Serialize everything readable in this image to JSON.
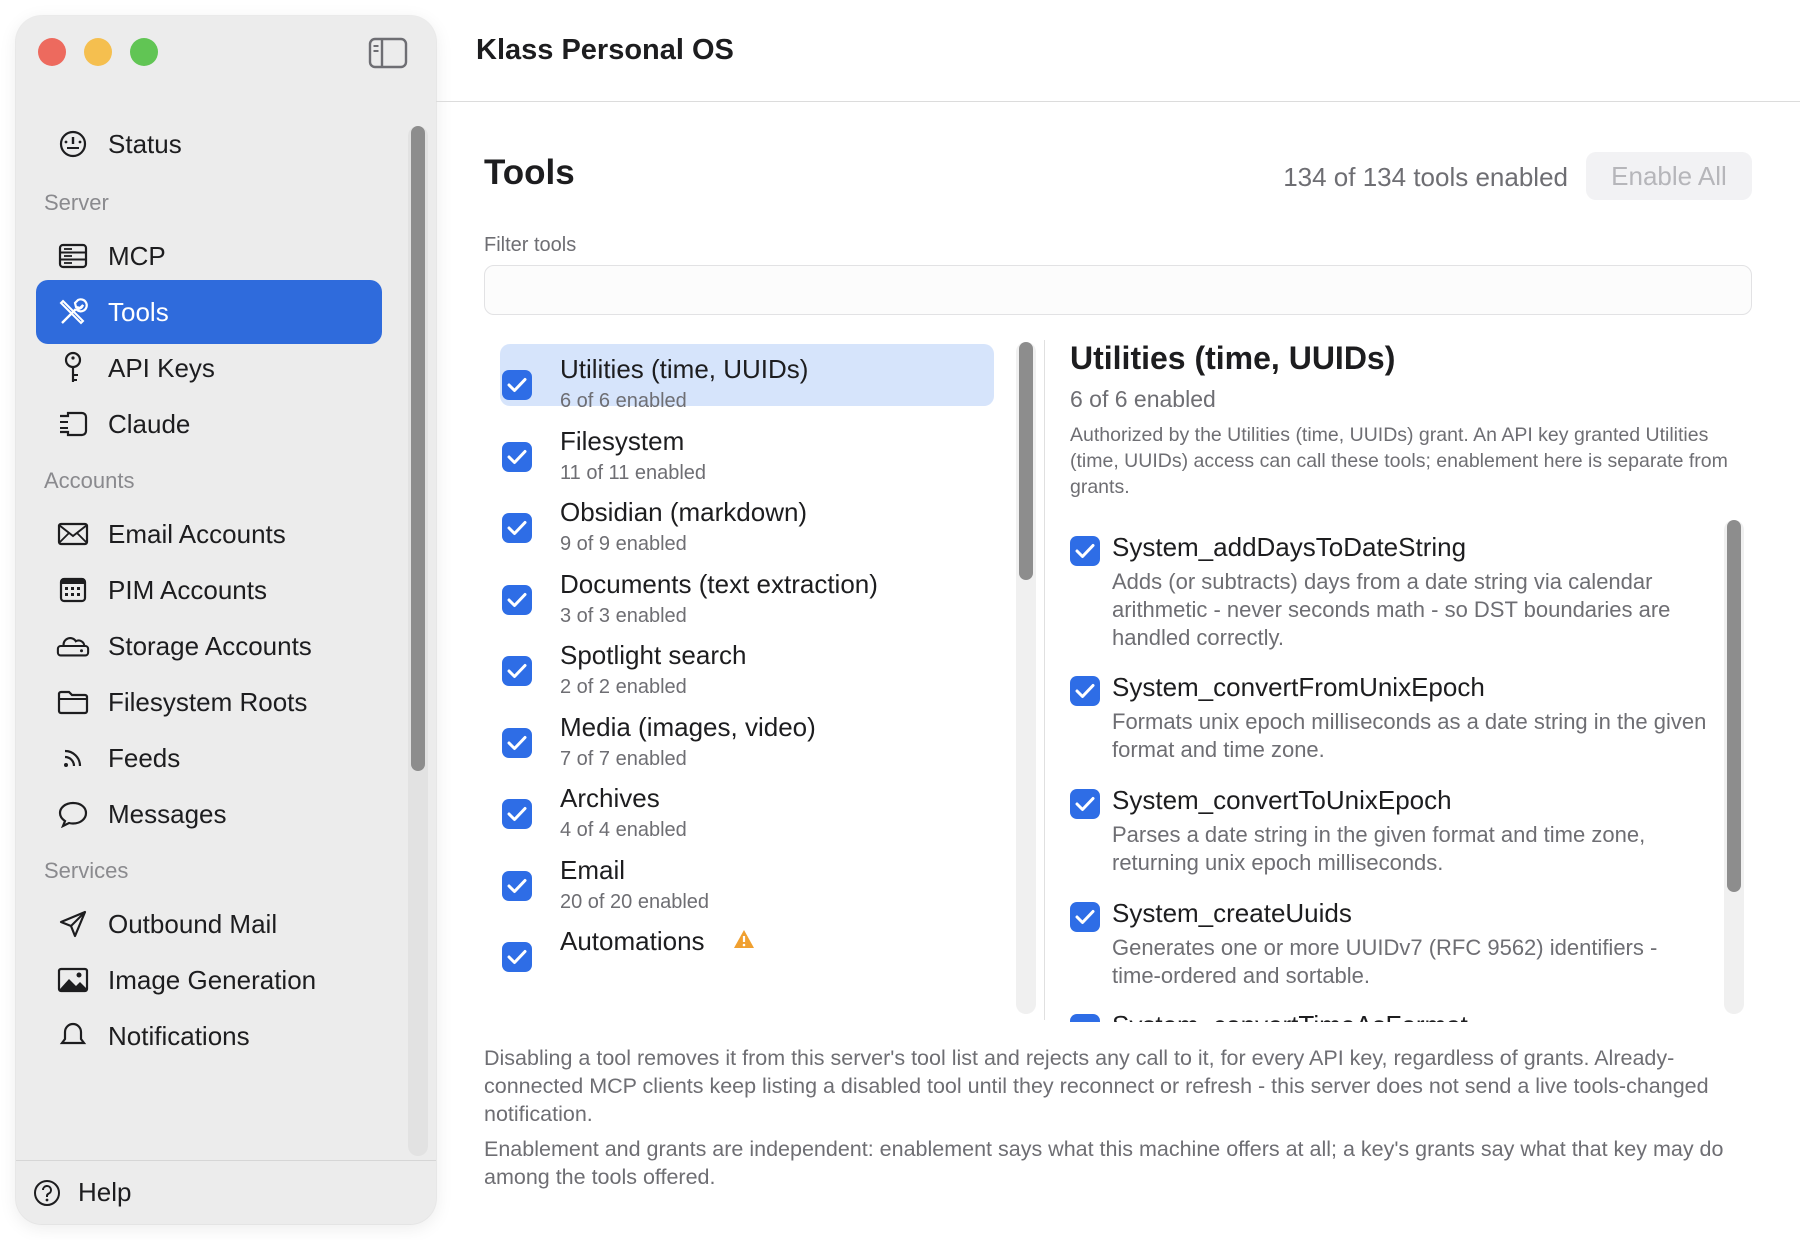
{
  "app_title": "Klass Personal OS",
  "sidebar": {
    "items": [
      {
        "id": "status",
        "label": "Status",
        "icon": "gauge-icon"
      },
      {
        "id": "mcp",
        "label": "MCP",
        "icon": "server-icon"
      },
      {
        "id": "tools",
        "label": "Tools",
        "icon": "wrench-screwdriver-icon",
        "active": true
      },
      {
        "id": "api-keys",
        "label": "API Keys",
        "icon": "key-icon"
      },
      {
        "id": "claude",
        "label": "Claude",
        "icon": "plug-icon"
      },
      {
        "id": "email-accounts",
        "label": "Email Accounts",
        "icon": "envelope-icon"
      },
      {
        "id": "pim-accounts",
        "label": "PIM Accounts",
        "icon": "calendar-icon"
      },
      {
        "id": "storage-accounts",
        "label": "Storage Accounts",
        "icon": "cloud-drive-icon"
      },
      {
        "id": "filesystem-roots",
        "label": "Filesystem Roots",
        "icon": "folder-icon"
      },
      {
        "id": "feeds",
        "label": "Feeds",
        "icon": "rss-icon"
      },
      {
        "id": "messages",
        "label": "Messages",
        "icon": "speech-bubble-icon"
      },
      {
        "id": "outbound-mail",
        "label": "Outbound Mail",
        "icon": "paper-plane-icon"
      },
      {
        "id": "image-generation",
        "label": "Image Generation",
        "icon": "photo-icon"
      },
      {
        "id": "notifications",
        "label": "Notifications",
        "icon": "bell-icon"
      }
    ],
    "sections": {
      "server": "Server",
      "accounts": "Accounts",
      "services": "Services"
    },
    "help": "Help"
  },
  "main": {
    "title": "Tools",
    "count_text": "134 of 134 tools enabled",
    "enable_all": "Enable All",
    "filter_label": "Filter tools",
    "filter_value": "",
    "groups": [
      {
        "name": "Utilities (time, UUIDs)",
        "sub": "6 of 6 enabled",
        "selected": true
      },
      {
        "name": "Filesystem",
        "sub": "11 of 11 enabled"
      },
      {
        "name": "Obsidian (markdown)",
        "sub": "9 of 9 enabled"
      },
      {
        "name": "Documents (text extraction)",
        "sub": "3 of 3 enabled"
      },
      {
        "name": "Spotlight search",
        "sub": "2 of 2 enabled"
      },
      {
        "name": "Media (images, video)",
        "sub": "7 of 7 enabled"
      },
      {
        "name": "Archives",
        "sub": "4 of 4 enabled"
      },
      {
        "name": "Email",
        "sub": "20 of 20 enabled"
      },
      {
        "name": "Automations",
        "sub": "",
        "warning": true
      }
    ],
    "detail": {
      "title": "Utilities (time, UUIDs)",
      "sub": "6 of 6 enabled",
      "description": "Authorized by the Utilities (time, UUIDs) grant. An API key granted Utilities (time, UUIDs) access can call these tools; enablement here is separate from grants.",
      "tools": [
        {
          "name": "System_addDaysToDateString",
          "desc": "Adds (or subtracts) days from a date string via calendar arithmetic - never seconds math - so DST boundaries are handled correctly."
        },
        {
          "name": "System_convertFromUnixEpoch",
          "desc": "Formats unix epoch milliseconds as a date string in the given format and time zone."
        },
        {
          "name": "System_convertToUnixEpoch",
          "desc": "Parses a date string in the given format and time zone, returning unix epoch milliseconds."
        },
        {
          "name": "System_createUuids",
          "desc": "Generates one or more UUIDv7 (RFC 9562) identifiers - time-ordered and sortable."
        },
        {
          "name": "System_convertTimeAsFormat",
          "desc": ""
        }
      ]
    },
    "footnote_1": "Disabling a tool removes it from this server's tool list and rejects any call to it, for every API key, regardless of grants. Already-connected MCP clients keep listing a disabled tool until they reconnect or refresh - this server does not send a live tools-changed notification.",
    "footnote_2": "Enablement and grants are independent: enablement says what this machine offers at all; a key's grants say what that key may do among the tools offered."
  }
}
